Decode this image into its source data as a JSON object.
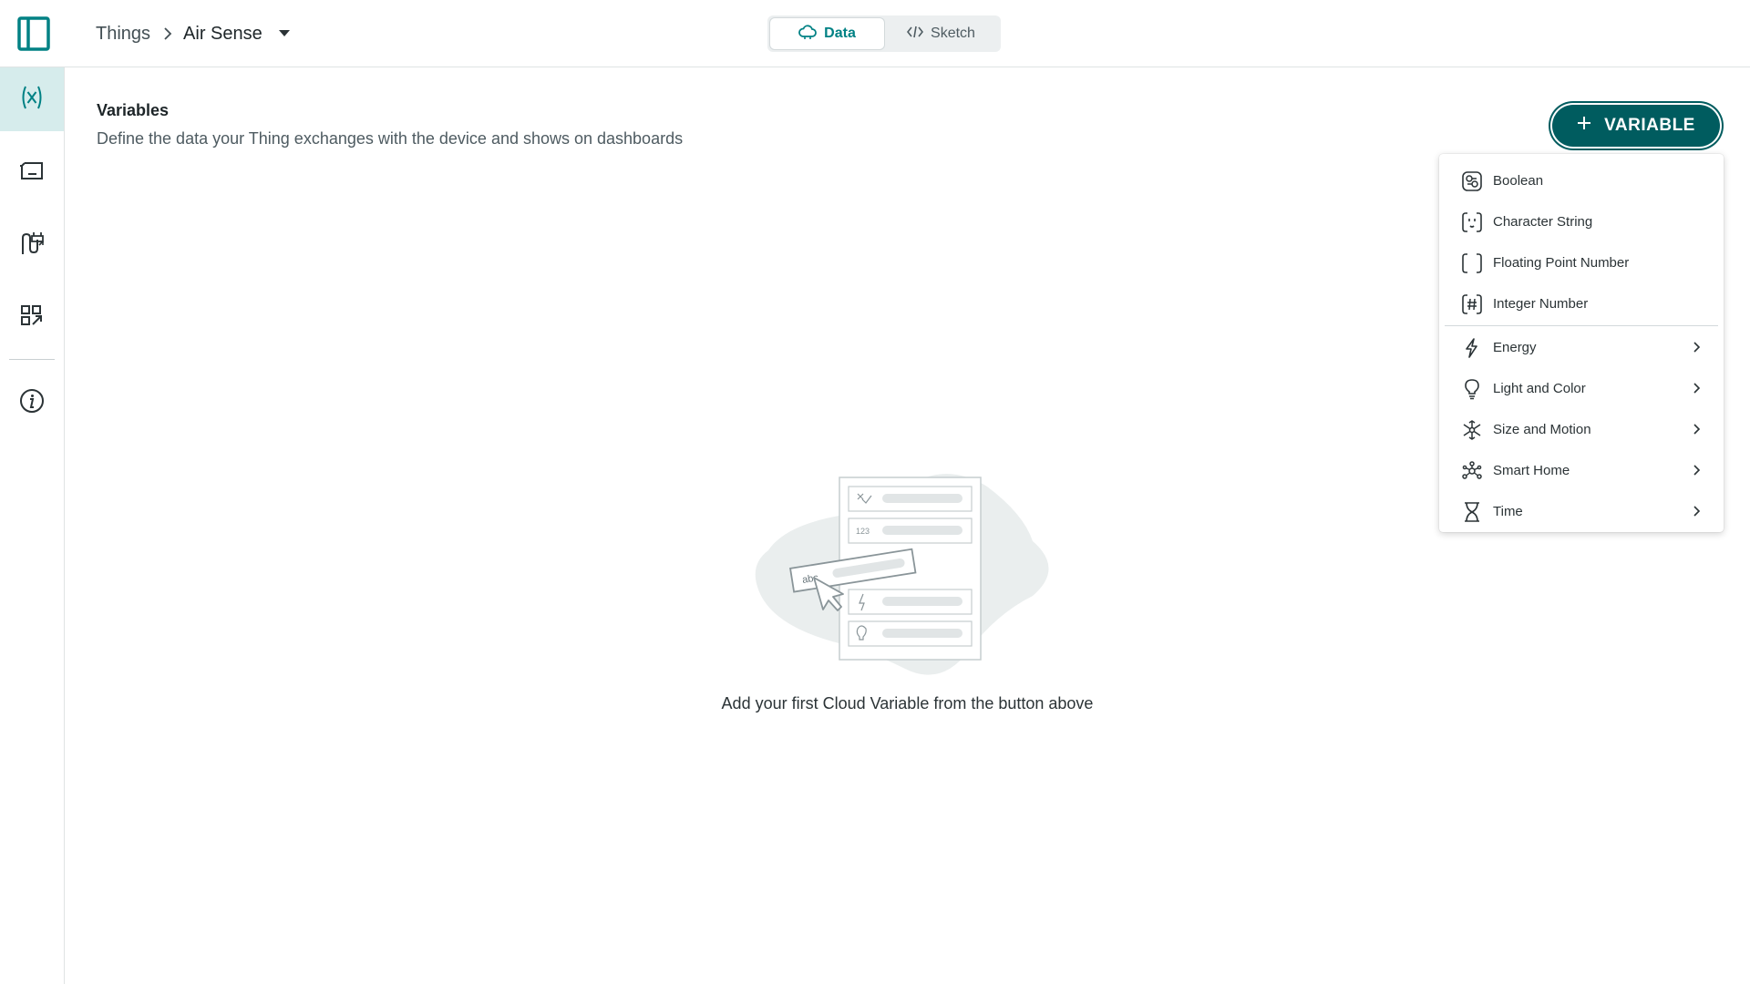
{
  "breadcrumb": {
    "parent": "Things",
    "current": "Air Sense"
  },
  "view_tabs": [
    {
      "label": "Data",
      "icon": "cloud-icon",
      "active": true
    },
    {
      "label": "Sketch",
      "icon": "code-icon",
      "active": false
    }
  ],
  "leftnav": [
    {
      "name": "variables",
      "icon": "variable-icon",
      "active": true
    },
    {
      "name": "devices",
      "icon": "device-icon",
      "active": false
    },
    {
      "name": "triggers",
      "icon": "trigger-icon",
      "active": false
    },
    {
      "name": "dashboards",
      "icon": "dashboard-link-icon",
      "active": false
    },
    {
      "name": "info",
      "icon": "info-icon",
      "active": false
    }
  ],
  "main": {
    "title": "Variables",
    "description": "Define the data your Thing exchanges with the device and shows on dashboards",
    "add_button_label": "VARIABLE",
    "empty_state_text": "Add your first Cloud Variable from the button above",
    "illustration_labels": {
      "abc": "abc",
      "num": "123"
    }
  },
  "variable_menu": {
    "basic": [
      {
        "label": "Boolean",
        "icon": "boolean-icon"
      },
      {
        "label": "Character String",
        "icon": "string-icon"
      },
      {
        "label": "Floating Point Number",
        "icon": "float-icon"
      },
      {
        "label": "Integer Number",
        "icon": "integer-icon"
      }
    ],
    "groups": [
      {
        "label": "Energy",
        "icon": "energy-icon"
      },
      {
        "label": "Light and Color",
        "icon": "lightbulb-icon"
      },
      {
        "label": "Size and Motion",
        "icon": "motion-icon"
      },
      {
        "label": "Smart Home",
        "icon": "smart-home-icon"
      },
      {
        "label": "Time",
        "icon": "hourglass-icon"
      }
    ]
  },
  "colors": {
    "accent": "#008184",
    "button": "#005c5f",
    "nav_active": "#d6ecec"
  }
}
